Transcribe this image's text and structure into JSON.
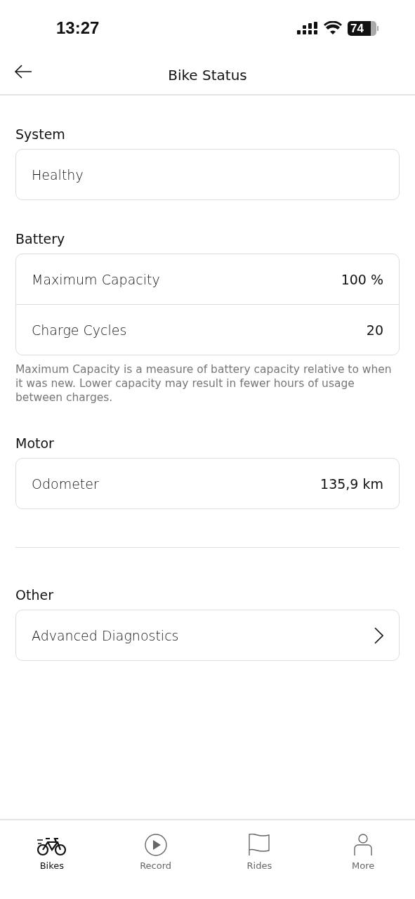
{
  "status_bar": {
    "time": "13:27",
    "battery": "74"
  },
  "header": {
    "title": "Bike Status"
  },
  "sections": [
    {
      "title": "System",
      "rows": [
        {
          "kind": "plain",
          "label": "Healthy"
        }
      ]
    },
    {
      "title": "Battery",
      "rows": [
        {
          "kind": "value",
          "label": "Maximum Capacity",
          "value": "100 %"
        },
        {
          "kind": "value",
          "label": "Charge Cycles",
          "value": "20"
        }
      ],
      "note": "Maximum Capacity is a measure of battery capacity relative to when it was new. Lower capacity may result in fewer hours of usage between charges."
    },
    {
      "title": "Motor",
      "rows": [
        {
          "kind": "value",
          "label": "Odometer",
          "value": "135,9 km"
        }
      ],
      "divider_after": true
    },
    {
      "title": "Other",
      "rows": [
        {
          "kind": "link",
          "label": "Advanced Diagnostics"
        }
      ]
    }
  ],
  "tabs": [
    {
      "label": "Bikes",
      "selected": true
    },
    {
      "label": "Record",
      "selected": false
    },
    {
      "label": "Rides",
      "selected": false
    },
    {
      "label": "More",
      "selected": false
    }
  ]
}
